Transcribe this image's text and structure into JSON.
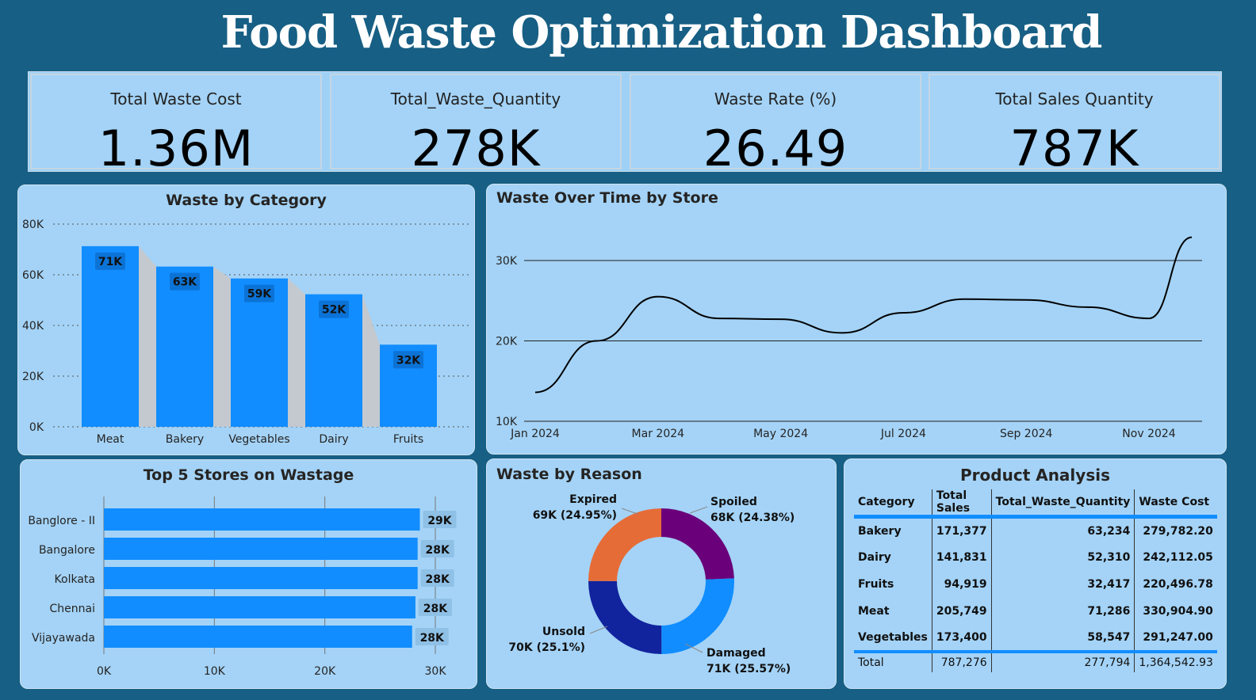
{
  "title": "Food Waste Optimization Dashboard",
  "kpis": [
    {
      "label": "Total Waste Cost",
      "value": "1.36M"
    },
    {
      "label": "Total_Waste_Quantity",
      "value": "278K"
    },
    {
      "label": "Waste Rate (%)",
      "value": "26.49"
    },
    {
      "label": "Total Sales Quantity",
      "value": "787K"
    }
  ],
  "colors": {
    "bar": "#118dff",
    "line": "#000000",
    "panel": "#a4d3f7",
    "background": "#175f84"
  },
  "charts": {
    "category": {
      "title": "Waste by Category",
      "type": "bar",
      "categories": [
        "Meat",
        "Bakery",
        "Vegetables",
        "Dairy",
        "Fruits"
      ],
      "values": [
        71286,
        63234,
        58547,
        52310,
        32417
      ],
      "labels": [
        "71K",
        "63K",
        "59K",
        "52K",
        "32K"
      ],
      "yticks": [
        "0K",
        "20K",
        "40K",
        "60K",
        "80K"
      ],
      "ylim": [
        0,
        80000
      ]
    },
    "time": {
      "title": "Waste Over Time by Store",
      "type": "line",
      "x": [
        "Jan 2024",
        "Feb 2024",
        "Mar 2024",
        "Apr 2024",
        "May 2024",
        "Jun 2024",
        "Jul 2024",
        "Aug 2024",
        "Sep 2024",
        "Oct 2024",
        "Nov 2024",
        "Dec 2024"
      ],
      "values": [
        13600,
        20000,
        25500,
        22800,
        22700,
        21000,
        23500,
        25200,
        25100,
        24200,
        22800,
        32900
      ],
      "xticks": [
        "Jan 2024",
        "Mar 2024",
        "May 2024",
        "Jul 2024",
        "Sep 2024",
        "Nov 2024"
      ],
      "yticks": [
        "10K",
        "20K",
        "30K"
      ],
      "ylim": [
        10000,
        32900
      ]
    },
    "stores": {
      "title": "Top 5 Stores on Wastage",
      "type": "bar",
      "categories": [
        "Banglore - II",
        "Bangalore",
        "Kolkata",
        "Chennai",
        "Vijayawada"
      ],
      "values": [
        28600,
        28400,
        28400,
        28200,
        27900
      ],
      "labels": [
        "29K",
        "28K",
        "28K",
        "28K",
        "28K"
      ],
      "xticks": [
        "0K",
        "10K",
        "20K",
        "30K"
      ],
      "xlim": [
        0,
        30000
      ]
    },
    "reason": {
      "title": "Waste by Reason",
      "type": "pie",
      "slices": [
        {
          "name": "Spoiled",
          "value": "68K (24.38%)",
          "pct": 24.38,
          "color": "#6b007b"
        },
        {
          "name": "Damaged",
          "value": "71K (25.57%)",
          "pct": 25.57,
          "color": "#118dff"
        },
        {
          "name": "Unsold",
          "value": "70K (25.1%)",
          "pct": 25.1,
          "color": "#12239e"
        },
        {
          "name": "Expired",
          "value": "69K (24.95%)",
          "pct": 24.95,
          "color": "#e66c37"
        }
      ]
    },
    "table": {
      "title": "Product Analysis",
      "type": "table",
      "columns": [
        "Category",
        "Total Sales",
        "Total_Waste_Quantity",
        "Waste Cost"
      ],
      "rows": [
        [
          "Bakery",
          "171,377",
          "63,234",
          "279,782.20"
        ],
        [
          "Dairy",
          "141,831",
          "52,310",
          "242,112.05"
        ],
        [
          "Fruits",
          "94,919",
          "32,417",
          "220,496.78"
        ],
        [
          "Meat",
          "205,749",
          "71,286",
          "330,904.90"
        ],
        [
          "Vegetables",
          "173,400",
          "58,547",
          "291,247.00"
        ]
      ],
      "total": [
        "Total",
        "787,276",
        "277,794",
        "1,364,542.93"
      ]
    }
  }
}
